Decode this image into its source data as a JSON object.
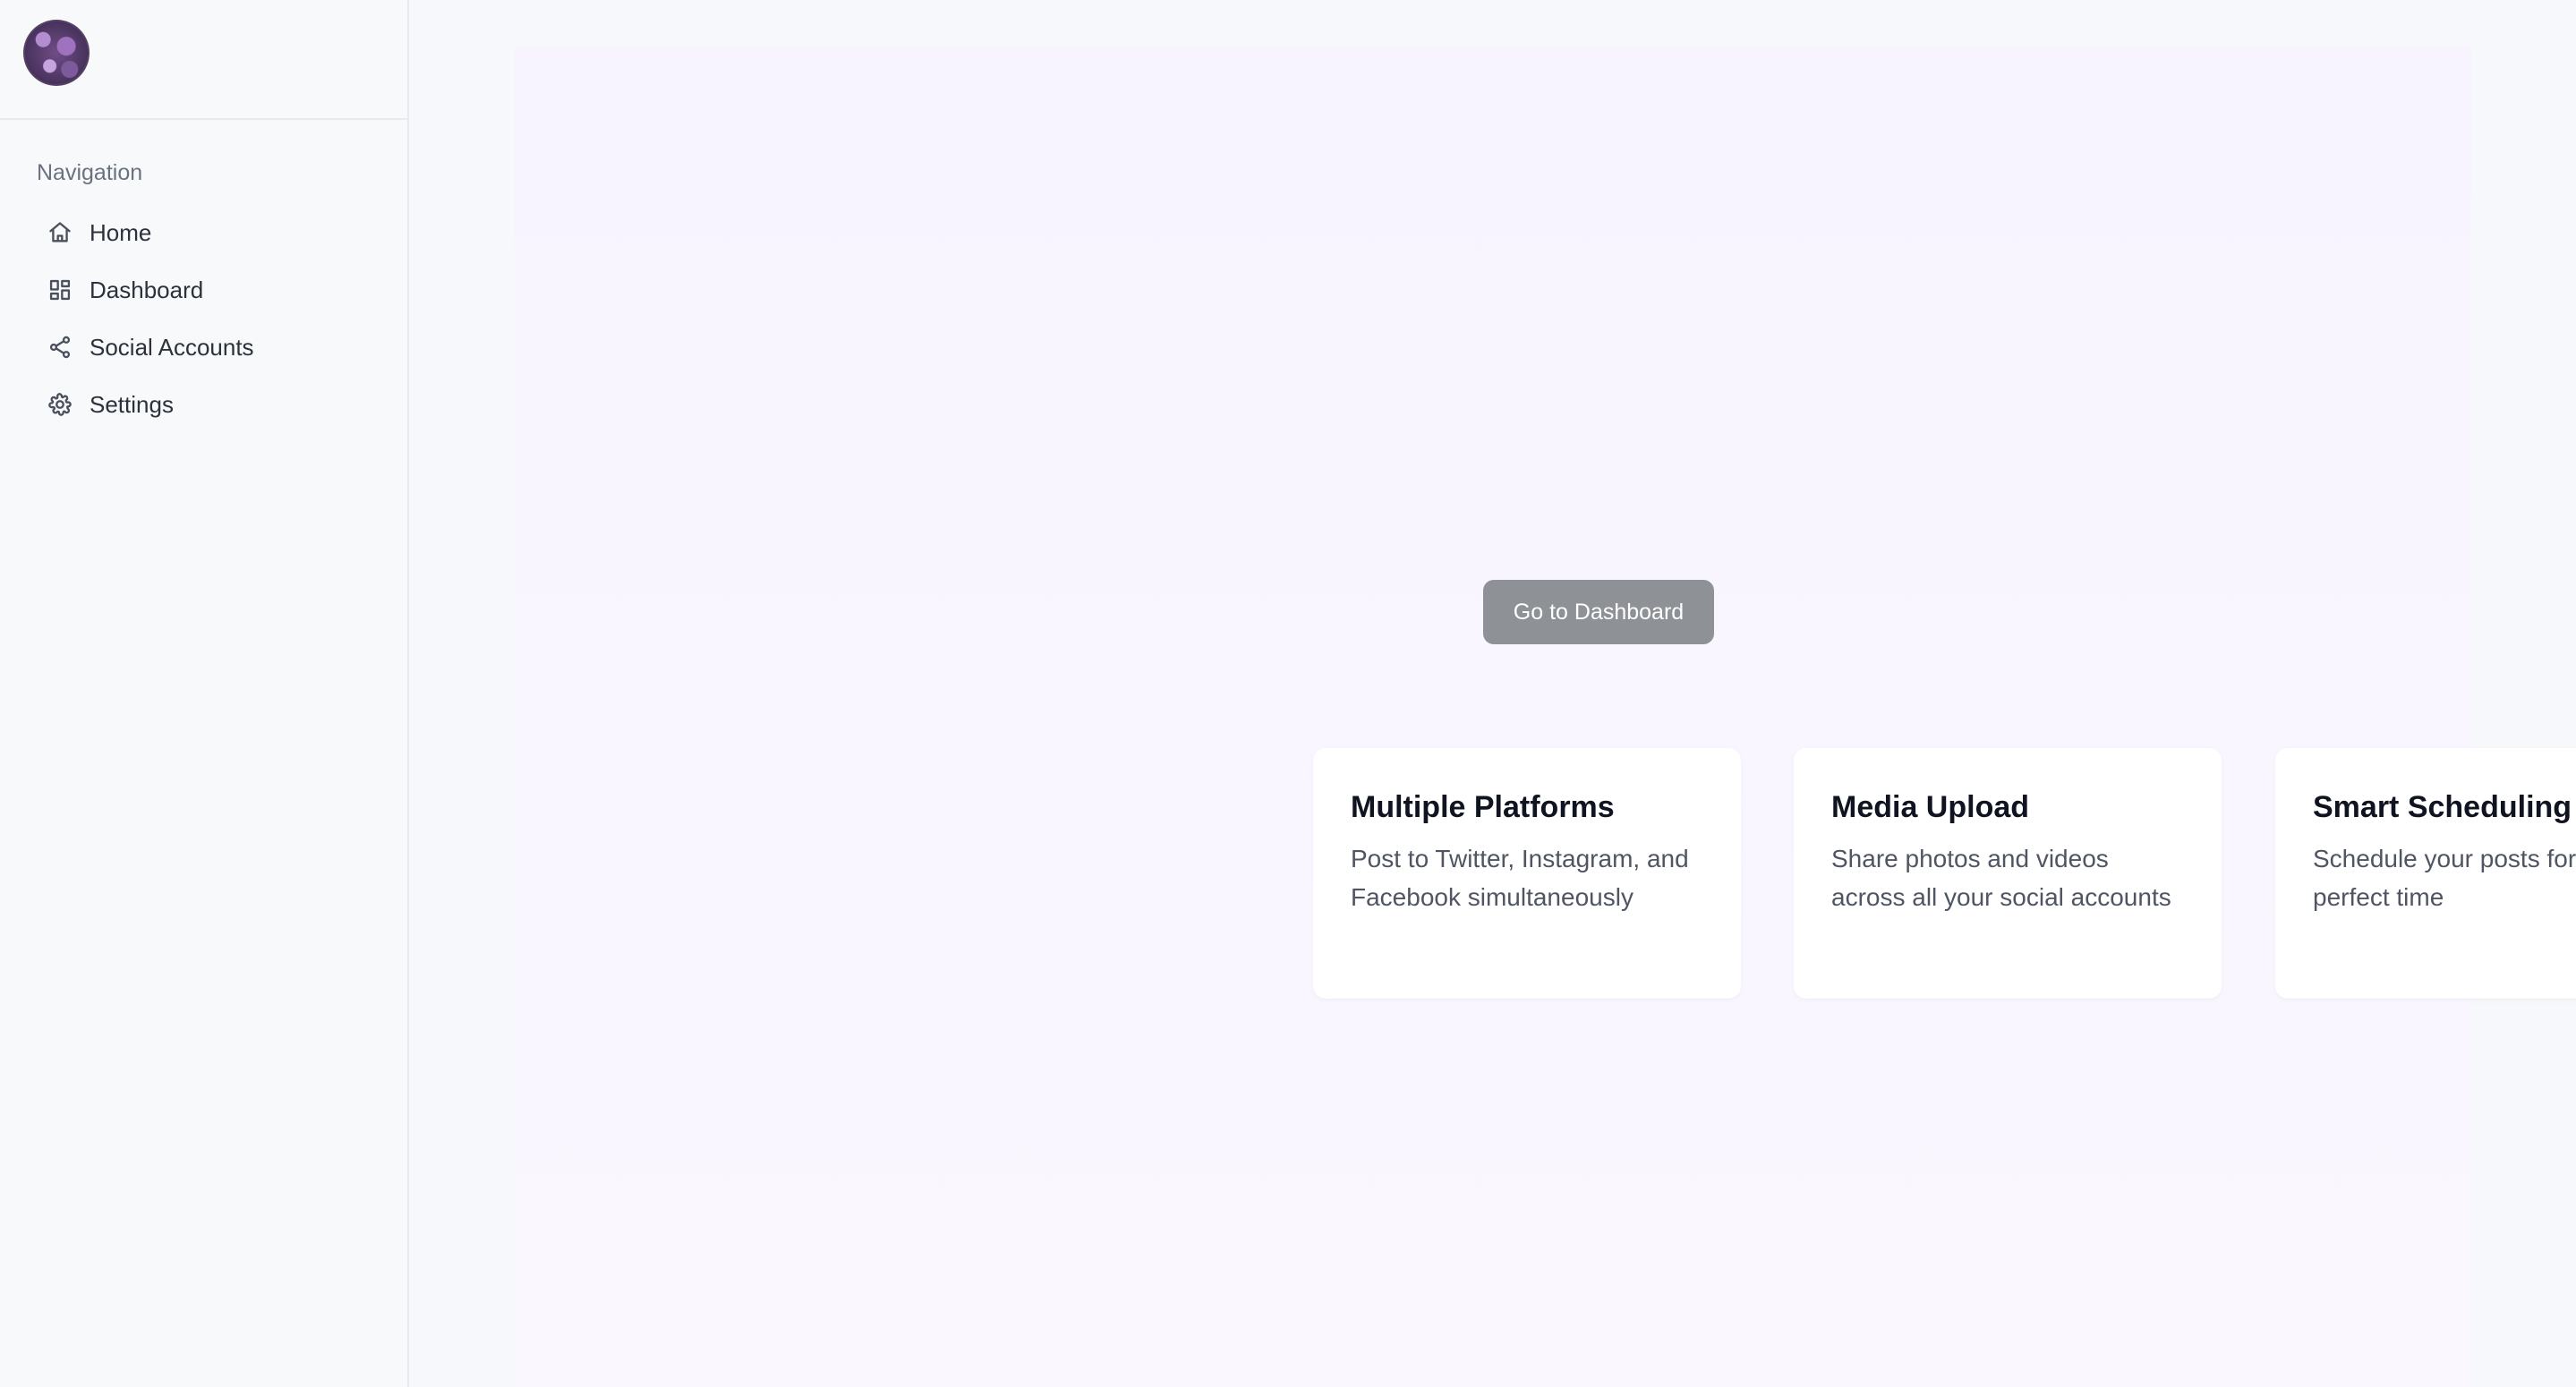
{
  "sidebar": {
    "section_title": "Navigation",
    "items": [
      {
        "label": "Home",
        "icon": "home-icon"
      },
      {
        "label": "Dashboard",
        "icon": "dashboard-icon"
      },
      {
        "label": "Social Accounts",
        "icon": "share-icon"
      },
      {
        "label": "Settings",
        "icon": "gear-icon"
      }
    ]
  },
  "main": {
    "cta_label": "Go to Dashboard",
    "features": [
      {
        "title": "Multiple Platforms",
        "description": "Post to Twitter, Instagram, and Facebook simultaneously"
      },
      {
        "title": "Media Upload",
        "description": "Share photos and videos across all your social accounts"
      },
      {
        "title": "Smart Scheduling",
        "description": "Schedule your posts for the perfect time"
      }
    ]
  },
  "colors": {
    "page_bg": "#f7f8fb",
    "sidebar_border": "#e8eaef",
    "button_bg": "#8e9196",
    "card_bg": "#ffffff",
    "heading_text": "#0f1420",
    "body_text": "#4f5562"
  }
}
